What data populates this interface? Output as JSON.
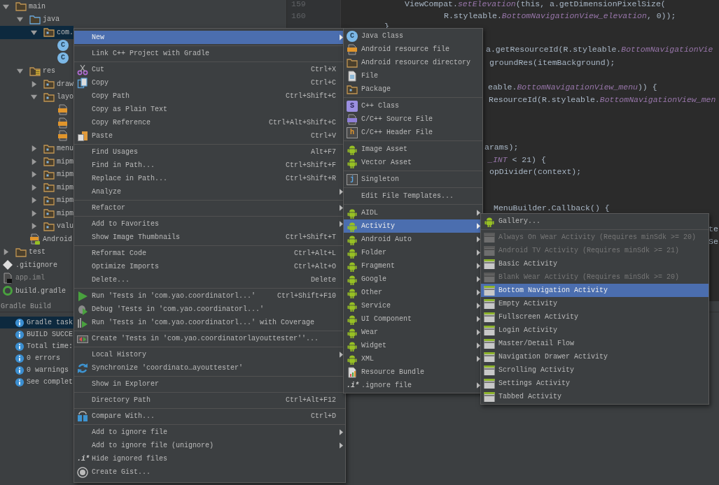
{
  "project_tree": {
    "items": [
      {
        "label": "main",
        "kind": "folder",
        "expanded": true,
        "selected": false,
        "children": [
          {
            "label": "java",
            "kind": "source_folder",
            "expanded": true,
            "selected": false,
            "children": [
              {
                "label": "com.",
                "kind": "package",
                "expanded": true,
                "selected": true,
                "children": [
                  {
                    "kind": "class",
                    "icon_text": "C",
                    "selected": false
                  },
                  {
                    "kind": "class",
                    "icon_text": "C",
                    "selected": false
                  }
                ]
              }
            ]
          },
          {
            "label": "res",
            "kind": "res_folder",
            "expanded": true,
            "selected": false,
            "children": [
              {
                "label": "draw",
                "kind": "package",
                "expanded": false,
                "selected": false
              },
              {
                "label": "layo",
                "kind": "package",
                "expanded": true,
                "selected": false,
                "children": [
                  {
                    "kind": "xml",
                    "selected": false
                  },
                  {
                    "kind": "xml",
                    "selected": false
                  },
                  {
                    "kind": "xml",
                    "selected": false
                  }
                ]
              },
              {
                "label": "menu",
                "kind": "package",
                "expanded": false,
                "selected": false
              },
              {
                "label": "mipm",
                "kind": "package",
                "expanded": false,
                "selected": false
              },
              {
                "label": "mipm",
                "kind": "package",
                "expanded": false,
                "selected": false
              },
              {
                "label": "mipm",
                "kind": "package",
                "expanded": false,
                "selected": false
              },
              {
                "label": "mipm",
                "kind": "package",
                "expanded": false,
                "selected": false
              },
              {
                "label": "mipm",
                "kind": "package",
                "expanded": false,
                "selected": false
              },
              {
                "label": "valu",
                "kind": "package",
                "expanded": false,
                "selected": false
              }
            ]
          },
          {
            "label": "Android",
            "kind": "manifest",
            "selected": false
          }
        ]
      },
      {
        "label": "test",
        "kind": "folder",
        "expanded": false,
        "selected": false
      },
      {
        "label": ".gitignore",
        "kind": "gitignore",
        "selected": false
      },
      {
        "label": "app.iml",
        "kind": "iml",
        "selected": false
      },
      {
        "label": "build.gradle",
        "kind": "gradle",
        "selected": false
      }
    ]
  },
  "editor": {
    "line_numbers": [
      "159",
      "160"
    ],
    "code_lines": [
      {
        "text": "ViewCompat.*setElevation*(this, a.getDimensionPixelSize("
      },
      {
        "text": "R.styleable.*BottomNavigationView_elevation*, 0));"
      },
      {
        "text": "}"
      },
      {
        "text": "a.getResourceId(R.styleable.*BottomNavigationVie*"
      },
      {
        "text": "groundRes(itemBackground);"
      },
      {
        "text": "eable.*BottomNavigationView_menu*)) {"
      },
      {
        "text": "ResourceId(R.styleable.*BottomNavigationView_men*"
      },
      {
        "text": "arams);"
      },
      {
        "text": "*_INT* < 21) {"
      },
      {
        "text": "opDivider(context);"
      },
      {
        "text": "MenuBuilder.Callback() {"
      },
      {
        "text": "te"
      },
      {
        "text": "Se"
      }
    ]
  },
  "build_panel": {
    "title": "Gradle Build",
    "messages": [
      {
        "text": "Gradle task",
        "selected": true
      },
      {
        "text": "BUILD SUCCE",
        "selected": false
      },
      {
        "text": "Total time:",
        "selected": false
      },
      {
        "text": "0 errors",
        "selected": false
      },
      {
        "text": "0 warnings",
        "selected": false
      },
      {
        "text": "See complet",
        "selected": false
      }
    ]
  },
  "context_menu": {
    "items": [
      {
        "kind": "item",
        "label": "New",
        "has_submenu": true,
        "selected": true
      },
      {
        "kind": "separator"
      },
      {
        "kind": "item",
        "label": "Link C++ Project with Gradle",
        "has_submenu": false,
        "selected": false
      },
      {
        "kind": "separator"
      },
      {
        "kind": "item",
        "label": "Cut",
        "shortcut": "Ctrl+X",
        "has_submenu": false,
        "selected": false
      },
      {
        "kind": "item",
        "label": "Copy",
        "shortcut": "Ctrl+C",
        "has_submenu": false,
        "selected": false
      },
      {
        "kind": "item",
        "label": "Copy Path",
        "shortcut": "Ctrl+Shift+C",
        "has_submenu": false,
        "selected": false
      },
      {
        "kind": "item",
        "label": "Copy as Plain Text",
        "has_submenu": false,
        "selected": false
      },
      {
        "kind": "item",
        "label": "Copy Reference",
        "shortcut": "Ctrl+Alt+Shift+C",
        "has_submenu": false,
        "selected": false
      },
      {
        "kind": "item",
        "label": "Paste",
        "shortcut": "Ctrl+V",
        "has_submenu": false,
        "selected": false
      },
      {
        "kind": "separator"
      },
      {
        "kind": "item",
        "label": "Find Usages",
        "shortcut": "Alt+F7",
        "has_submenu": false,
        "selected": false
      },
      {
        "kind": "item",
        "label": "Find in Path...",
        "shortcut": "Ctrl+Shift+F",
        "has_submenu": false,
        "selected": false
      },
      {
        "kind": "item",
        "label": "Replace in Path...",
        "shortcut": "Ctrl+Shift+R",
        "has_submenu": false,
        "selected": false
      },
      {
        "kind": "item",
        "label": "Analyze",
        "has_submenu": true,
        "selected": false
      },
      {
        "kind": "separator"
      },
      {
        "kind": "item",
        "label": "Refactor",
        "has_submenu": true,
        "selected": false
      },
      {
        "kind": "separator"
      },
      {
        "kind": "item",
        "label": "Add to Favorites",
        "has_submenu": true,
        "selected": false
      },
      {
        "kind": "item",
        "label": "Show Image Thumbnails",
        "shortcut": "Ctrl+Shift+T",
        "has_submenu": false,
        "selected": false
      },
      {
        "kind": "separator"
      },
      {
        "kind": "item",
        "label": "Reformat Code",
        "shortcut": "Ctrl+Alt+L",
        "has_submenu": false,
        "selected": false
      },
      {
        "kind": "item",
        "label": "Optimize Imports",
        "shortcut": "Ctrl+Alt+O",
        "has_submenu": false,
        "selected": false
      },
      {
        "kind": "item",
        "label": "Delete...",
        "shortcut": "Delete",
        "has_submenu": false,
        "selected": false
      },
      {
        "kind": "separator"
      },
      {
        "kind": "item",
        "label": "Run 'Tests in 'com.yao.coordinatorl...'",
        "shortcut": "Ctrl+Shift+F10",
        "has_submenu": false,
        "selected": false
      },
      {
        "kind": "item",
        "label": "Debug 'Tests in 'com.yao.coordinatorl...'",
        "has_submenu": false,
        "selected": false
      },
      {
        "kind": "item",
        "label": "Run 'Tests in 'com.yao.coordinatorl...' with Coverage",
        "has_submenu": false,
        "selected": false
      },
      {
        "kind": "separator"
      },
      {
        "kind": "item",
        "label": "Create 'Tests in 'com.yao.coordinatorlayouttester''...",
        "has_submenu": false,
        "selected": false
      },
      {
        "kind": "separator"
      },
      {
        "kind": "item",
        "label": "Local History",
        "has_submenu": true,
        "selected": false
      },
      {
        "kind": "item",
        "label": "Synchronize 'coordinato…ayouttester'",
        "has_submenu": false,
        "selected": false
      },
      {
        "kind": "separator"
      },
      {
        "kind": "item",
        "label": "Show in Explorer",
        "has_submenu": false,
        "selected": false
      },
      {
        "kind": "separator"
      },
      {
        "kind": "item",
        "label": "Directory Path",
        "shortcut": "Ctrl+Alt+F12",
        "has_submenu": false,
        "selected": false
      },
      {
        "kind": "separator"
      },
      {
        "kind": "item",
        "label": "Compare With...",
        "shortcut": "Ctrl+D",
        "has_submenu": false,
        "selected": false
      },
      {
        "kind": "separator"
      },
      {
        "kind": "item",
        "label": "Add to ignore file",
        "has_submenu": true,
        "selected": false
      },
      {
        "kind": "item",
        "label": "Add to ignore file (unignore)",
        "has_submenu": true,
        "selected": false
      },
      {
        "kind": "item",
        "label": "Hide ignored files",
        "icon_text": ".i*",
        "has_submenu": false,
        "selected": false
      },
      {
        "kind": "item",
        "label": "Create Gist...",
        "has_submenu": false,
        "selected": false
      }
    ]
  },
  "new_submenu": {
    "items": [
      {
        "kind": "item",
        "label": "Java Class",
        "icon_text": "C",
        "has_submenu": false,
        "selected": false
      },
      {
        "kind": "item",
        "label": "Android resource file",
        "has_submenu": false,
        "selected": false
      },
      {
        "kind": "item",
        "label": "Android resource directory",
        "has_submenu": false,
        "selected": false
      },
      {
        "kind": "item",
        "label": "File",
        "has_submenu": false,
        "selected": false
      },
      {
        "kind": "item",
        "label": "Package",
        "has_submenu": false,
        "selected": false
      },
      {
        "kind": "separator"
      },
      {
        "kind": "item",
        "label": "C++ Class",
        "icon_text": "S",
        "has_submenu": false,
        "selected": false
      },
      {
        "kind": "item",
        "label": "C/C++ Source File",
        "has_submenu": false,
        "selected": false
      },
      {
        "kind": "item",
        "label": "C/C++ Header File",
        "icon_text": "h",
        "has_submenu": false,
        "selected": false
      },
      {
        "kind": "separator"
      },
      {
        "kind": "item",
        "label": "Image Asset",
        "has_submenu": false,
        "selected": false
      },
      {
        "kind": "item",
        "label": "Vector Asset",
        "has_submenu": false,
        "selected": false
      },
      {
        "kind": "separator"
      },
      {
        "kind": "item",
        "label": "Singleton",
        "icon_text": "j",
        "has_submenu": false,
        "selected": false
      },
      {
        "kind": "separator"
      },
      {
        "kind": "item",
        "label": "Edit File Templates...",
        "has_submenu": false,
        "selected": false
      },
      {
        "kind": "separator"
      },
      {
        "kind": "item",
        "label": "AIDL",
        "has_submenu": true,
        "selected": false
      },
      {
        "kind": "item",
        "label": "Activity",
        "has_submenu": true,
        "selected": true
      },
      {
        "kind": "item",
        "label": "Android Auto",
        "has_submenu": true,
        "selected": false
      },
      {
        "kind": "item",
        "label": "Folder",
        "has_submenu": true,
        "selected": false
      },
      {
        "kind": "item",
        "label": "Fragment",
        "has_submenu": true,
        "selected": false
      },
      {
        "kind": "item",
        "label": "Google",
        "has_submenu": true,
        "selected": false
      },
      {
        "kind": "item",
        "label": "Other",
        "has_submenu": true,
        "selected": false
      },
      {
        "kind": "item",
        "label": "Service",
        "has_submenu": true,
        "selected": false
      },
      {
        "kind": "item",
        "label": "UI Component",
        "has_submenu": true,
        "selected": false
      },
      {
        "kind": "item",
        "label": "Wear",
        "has_submenu": true,
        "selected": false
      },
      {
        "kind": "item",
        "label": "Widget",
        "has_submenu": true,
        "selected": false
      },
      {
        "kind": "item",
        "label": "XML",
        "has_submenu": true,
        "selected": false
      },
      {
        "kind": "item",
        "label": "Resource Bundle",
        "has_submenu": false,
        "selected": false
      },
      {
        "kind": "item",
        "label": ".ignore file",
        "icon_text": ".i*",
        "has_submenu": true,
        "selected": false
      }
    ]
  },
  "activity_submenu": {
    "items": [
      {
        "kind": "item",
        "label": "Gallery...",
        "disabled": false,
        "selected": false
      },
      {
        "kind": "separator"
      },
      {
        "kind": "item",
        "label": "Always On Wear Activity (Requires minSdk >= 20)",
        "disabled": true,
        "selected": false
      },
      {
        "kind": "item",
        "label": "Android TV Activity (Requires minSdk >= 21)",
        "disabled": true,
        "selected": false
      },
      {
        "kind": "item",
        "label": "Basic Activity",
        "disabled": false,
        "selected": false
      },
      {
        "kind": "item",
        "label": "Blank Wear Activity (Requires minSdk >= 20)",
        "disabled": true,
        "selected": false
      },
      {
        "kind": "item",
        "label": "Bottom Navigation Activity",
        "disabled": false,
        "selected": true
      },
      {
        "kind": "item",
        "label": "Empty Activity",
        "disabled": false,
        "selected": false
      },
      {
        "kind": "item",
        "label": "Fullscreen Activity",
        "disabled": false,
        "selected": false
      },
      {
        "kind": "item",
        "label": "Login Activity",
        "disabled": false,
        "selected": false
      },
      {
        "kind": "item",
        "label": "Master/Detail Flow",
        "disabled": false,
        "selected": false
      },
      {
        "kind": "item",
        "label": "Navigation Drawer Activity",
        "disabled": false,
        "selected": false
      },
      {
        "kind": "item",
        "label": "Scrolling Activity",
        "disabled": false,
        "selected": false
      },
      {
        "kind": "item",
        "label": "Settings Activity",
        "disabled": false,
        "selected": false
      },
      {
        "kind": "item",
        "label": "Tabbed Activity",
        "disabled": false,
        "selected": false
      }
    ]
  }
}
